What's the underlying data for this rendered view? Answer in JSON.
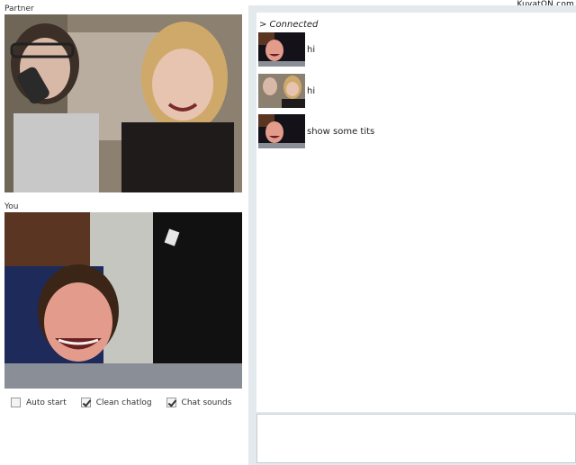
{
  "watermark": "KuvatON.com",
  "partner": {
    "label": "Partner"
  },
  "you": {
    "label": "You"
  },
  "controls": [
    {
      "label": "Auto start",
      "checked": false
    },
    {
      "label": "Clean chatlog",
      "checked": true
    },
    {
      "label": "Chat sounds",
      "checked": true
    }
  ],
  "chat": {
    "status": "> Connected",
    "messages": [
      {
        "sender": "you",
        "text": "hi"
      },
      {
        "sender": "partner",
        "text": "hi"
      },
      {
        "sender": "you",
        "text": "show some tits"
      }
    ],
    "input": ""
  }
}
